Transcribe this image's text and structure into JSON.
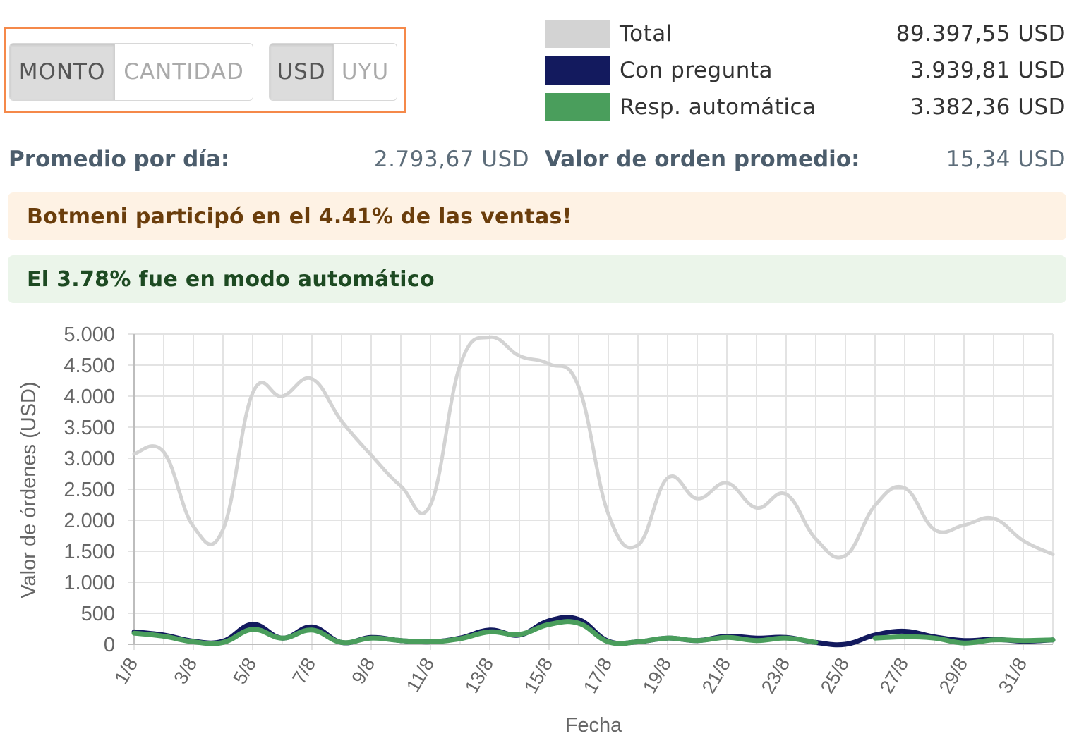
{
  "toggles": {
    "metric": [
      {
        "label": "MONTO",
        "active": true
      },
      {
        "label": "CANTIDAD",
        "active": false
      }
    ],
    "currency": [
      {
        "label": "USD",
        "active": true
      },
      {
        "label": "UYU",
        "active": false
      }
    ]
  },
  "legend": [
    {
      "label": "Total",
      "value": "89.397,55 USD",
      "color": "#d3d3d3"
    },
    {
      "label": "Con pregunta",
      "value": "3.939,81 USD",
      "color": "#131a5e"
    },
    {
      "label": "Resp. automática",
      "value": "3.382,36 USD",
      "color": "#4a9e5c"
    }
  ],
  "stats": {
    "daily_avg_label": "Promedio por día:",
    "daily_avg_value": "2.793,67 USD",
    "order_avg_label": "Valor de orden promedio:",
    "order_avg_value": "15,34 USD"
  },
  "banners": {
    "participation": "Botmeni participó en el 4.41% de las ventas!",
    "automatic": "El 3.78% fue en modo automático"
  },
  "chart_data": {
    "type": "line",
    "xlabel": "Fecha",
    "ylabel": "Valor de órdenes (USD)",
    "ylim": [
      0,
      5000
    ],
    "ytick_labels": [
      "0",
      "500",
      "1.000",
      "1.500",
      "2.000",
      "2.500",
      "3.000",
      "3.500",
      "4.000",
      "4.500",
      "5.000"
    ],
    "xtick_labels": [
      "1/8",
      "3/8",
      "5/8",
      "7/8",
      "9/8",
      "11/8",
      "13/8",
      "15/8",
      "17/8",
      "19/8",
      "21/8",
      "23/8",
      "25/8",
      "27/8",
      "29/8",
      "31/8"
    ],
    "grid": true,
    "categories": [
      "1/8",
      "2/8",
      "3/8",
      "4/8",
      "5/8",
      "6/8",
      "7/8",
      "8/8",
      "9/8",
      "10/8",
      "11/8",
      "12/8",
      "13/8",
      "14/8",
      "15/8",
      "16/8",
      "17/8",
      "18/8",
      "19/8",
      "20/8",
      "21/8",
      "22/8",
      "23/8",
      "24/8",
      "25/8",
      "26/8",
      "27/8",
      "28/8",
      "29/8",
      "30/8",
      "31/8",
      "1/9"
    ],
    "series": [
      {
        "name": "Total",
        "color": "#d3d3d3",
        "values": [
          3070,
          3100,
          1900,
          1850,
          4050,
          4000,
          4280,
          3600,
          3050,
          2550,
          2250,
          4500,
          4950,
          4650,
          4520,
          4150,
          2100,
          1600,
          2680,
          2350,
          2600,
          2200,
          2420,
          1700,
          1430,
          2240,
          2520,
          1850,
          1920,
          2030,
          1670,
          1450
        ]
      },
      {
        "name": "Con pregunta",
        "color": "#131a5e",
        "values": [
          200,
          150,
          50,
          50,
          320,
          100,
          280,
          30,
          110,
          60,
          40,
          100,
          230,
          150,
          380,
          400,
          50,
          40,
          100,
          60,
          130,
          100,
          110,
          30,
          0,
          150,
          210,
          120,
          60,
          80,
          50,
          70
        ]
      },
      {
        "name": "Resp. automática",
        "color": "#4a9e5c",
        "values": [
          180,
          130,
          40,
          30,
          240,
          100,
          230,
          30,
          100,
          60,
          40,
          90,
          200,
          160,
          320,
          340,
          40,
          40,
          100,
          60,
          110,
          60,
          100,
          30,
          null,
          100,
          120,
          100,
          20,
          70,
          60,
          70
        ]
      }
    ]
  }
}
